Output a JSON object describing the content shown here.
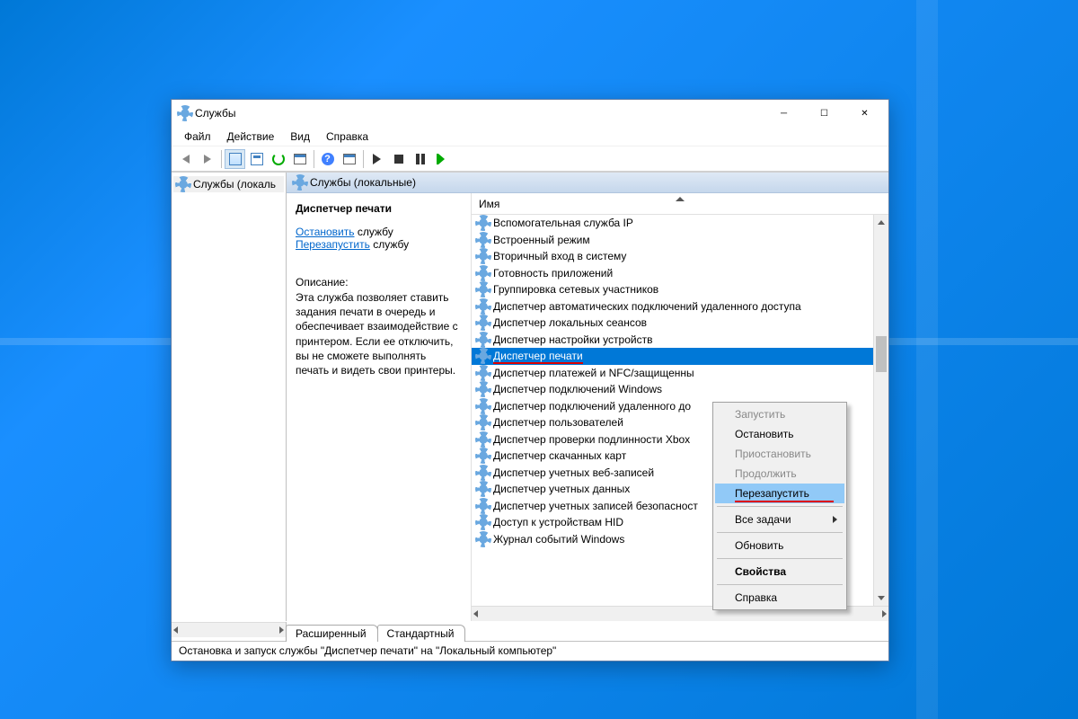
{
  "window": {
    "title": "Службы"
  },
  "menu": {
    "file": "Файл",
    "action": "Действие",
    "view": "Вид",
    "help": "Справка"
  },
  "tree": {
    "root": "Службы (локаль"
  },
  "mainHeader": "Службы (локальные)",
  "detail": {
    "serviceName": "Диспетчер печати",
    "linkStop": "Остановить",
    "linkRestart": "Перезапустить",
    "linkSuffix": " службу",
    "descLabel": "Описание:",
    "description": "Эта служба позволяет ставить задания печати в очередь и обеспечивает взаимодействие с принтером. Если ее отключить, вы не сможете выполнять печать и видеть свои принтеры."
  },
  "listHeader": {
    "name": "Имя"
  },
  "services": [
    {
      "name": "Вспомогательная служба IP",
      "sel": false
    },
    {
      "name": "Встроенный режим",
      "sel": false
    },
    {
      "name": "Вторичный вход в систему",
      "sel": false
    },
    {
      "name": "Готовность приложений",
      "sel": false
    },
    {
      "name": "Группировка сетевых участников",
      "sel": false
    },
    {
      "name": "Диспетчер автоматических подключений удаленного доступа",
      "sel": false
    },
    {
      "name": "Диспетчер локальных сеансов",
      "sel": false
    },
    {
      "name": "Диспетчер настройки устройств",
      "sel": false
    },
    {
      "name": "Диспетчер печати",
      "sel": true,
      "underline": true
    },
    {
      "name": "Диспетчер платежей и NFC/защищенны",
      "sel": false
    },
    {
      "name": "Диспетчер подключений Windows",
      "sel": false
    },
    {
      "name": "Диспетчер подключений удаленного до",
      "sel": false
    },
    {
      "name": "Диспетчер пользователей",
      "sel": false
    },
    {
      "name": "Диспетчер проверки подлинности Xbox",
      "sel": false
    },
    {
      "name": "Диспетчер скачанных карт",
      "sel": false
    },
    {
      "name": "Диспетчер учетных веб-записей",
      "sel": false
    },
    {
      "name": "Диспетчер учетных данных",
      "sel": false
    },
    {
      "name": "Диспетчер учетных записей безопасност",
      "sel": false
    },
    {
      "name": "Доступ к устройствам HID",
      "sel": false
    },
    {
      "name": "Журнал событий Windows",
      "sel": false
    }
  ],
  "contextMenu": {
    "items": [
      {
        "label": "Запустить",
        "disabled": true
      },
      {
        "label": "Остановить"
      },
      {
        "label": "Приостановить",
        "disabled": true
      },
      {
        "label": "Продолжить",
        "disabled": true
      },
      {
        "label": "Перезапустить",
        "highlight": true,
        "underline": true
      },
      {
        "sep": true
      },
      {
        "label": "Все задачи",
        "sub": true
      },
      {
        "sep": true
      },
      {
        "label": "Обновить"
      },
      {
        "sep": true
      },
      {
        "label": "Свойства",
        "bold": true
      },
      {
        "sep": true
      },
      {
        "label": "Справка"
      }
    ]
  },
  "tabs": {
    "extended": "Расширенный",
    "standard": "Стандартный"
  },
  "status": "Остановка и запуск службы \"Диспетчер печати\" на \"Локальный компьютер\""
}
